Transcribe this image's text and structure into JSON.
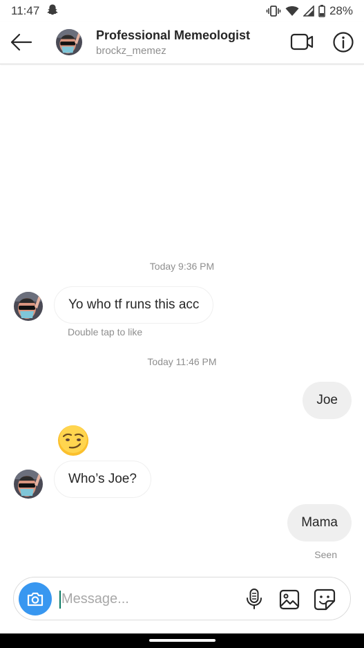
{
  "status_bar": {
    "time": "11:47",
    "battery": "28%",
    "icons": [
      "snapchat-ghost-icon",
      "vibrate-icon",
      "wifi-icon",
      "signal-icon",
      "battery-icon"
    ]
  },
  "header": {
    "title": "Professional Memeologist",
    "username": "brockz_memez",
    "icons": [
      "back-arrow-icon",
      "video-call-icon",
      "info-icon"
    ]
  },
  "chat": {
    "timestamps": [
      "Today 9:36 PM",
      "Today 11:46 PM"
    ],
    "messages": [
      {
        "from": "them",
        "text": "Yo who tf runs this acc"
      },
      {
        "from": "me",
        "text": "Joe"
      },
      {
        "from": "them",
        "type": "emoji",
        "emoji": "smirking-face"
      },
      {
        "from": "them",
        "text": "Who’s Joe?"
      },
      {
        "from": "me",
        "text": "Mama"
      }
    ],
    "double_tap_hint": "Double tap to like",
    "seen_label": "Seen"
  },
  "composer": {
    "placeholder": "Message...",
    "value": "",
    "icons": [
      "camera-icon",
      "microphone-icon",
      "gallery-icon",
      "sticker-icon"
    ],
    "camera_color": "#3897f0"
  },
  "colors": {
    "accent": "#3897f0",
    "text": "#262626",
    "secondary_text": "#8e8e8e",
    "outgoing_bubble": "#efefef",
    "border": "#dbdbdb"
  }
}
